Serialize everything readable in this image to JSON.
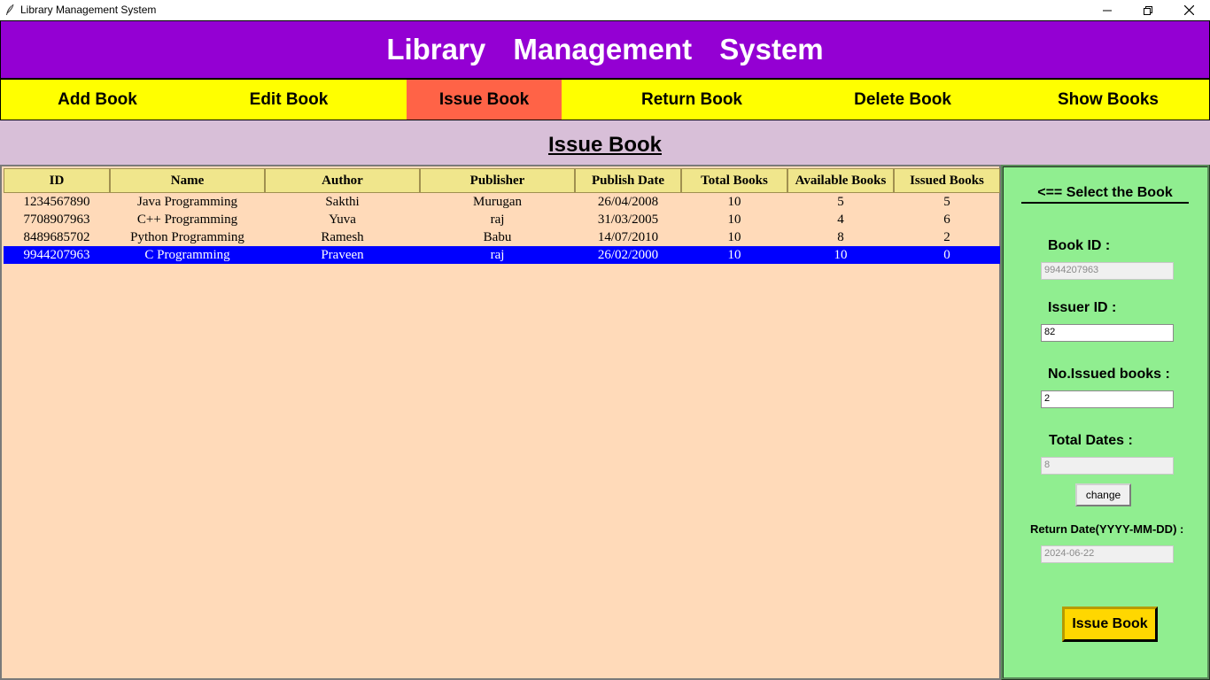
{
  "window": {
    "title": "Library Management System"
  },
  "header": {
    "title": "Library Management System"
  },
  "nav": {
    "items": [
      {
        "label": "Add Book"
      },
      {
        "label": "Edit Book"
      },
      {
        "label": "Issue Book"
      },
      {
        "label": "Return Book"
      },
      {
        "label": "Delete Book"
      },
      {
        "label": "Show Books"
      }
    ],
    "active": "Issue Book"
  },
  "page": {
    "title": "Issue Book"
  },
  "table": {
    "columns": [
      "ID",
      "Name",
      "Author",
      "Publisher",
      "Publish Date",
      "Total Books",
      "Available Books",
      "Issued Books"
    ],
    "rows": [
      [
        "1234567890",
        "Java Programming",
        "Sakthi",
        "Murugan",
        "26/04/2008",
        "10",
        "5",
        "5"
      ],
      [
        "7708907963",
        "C++ Programming",
        "Yuva",
        "raj",
        "31/03/2005",
        "10",
        "4",
        "6"
      ],
      [
        "8489685702",
        "Python Programming",
        "Ramesh",
        "Babu",
        "14/07/2010",
        "10",
        "8",
        "2"
      ],
      [
        "9944207963",
        "C Programming",
        "Praveen",
        "raj",
        "26/02/2000",
        "10",
        "10",
        "0"
      ]
    ],
    "selected_row": 3
  },
  "side": {
    "heading": "<== Select the Book",
    "book_id_label": "Book ID :",
    "book_id_value": "9944207963",
    "issuer_id_label": "Issuer ID :",
    "issuer_id_value": "82",
    "issued_label": "No.Issued books :",
    "issued_value": "2",
    "total_dates_label": "Total Dates :",
    "total_dates_value": "8",
    "change_label": "change",
    "return_label": "Return Date(YYYY-MM-DD) :",
    "return_value": "2024-06-22",
    "issue_button": "Issue Book"
  },
  "colors": {
    "header": "#9400d3",
    "nav": "#ffff00",
    "nav_active": "#ff6347",
    "band": "#d8bfd8",
    "table_bg": "#ffdab9",
    "table_header": "#f0e68c",
    "selected_row": "#0000ff",
    "side_panel": "#90ee90",
    "issue_button": "#ffd700"
  }
}
